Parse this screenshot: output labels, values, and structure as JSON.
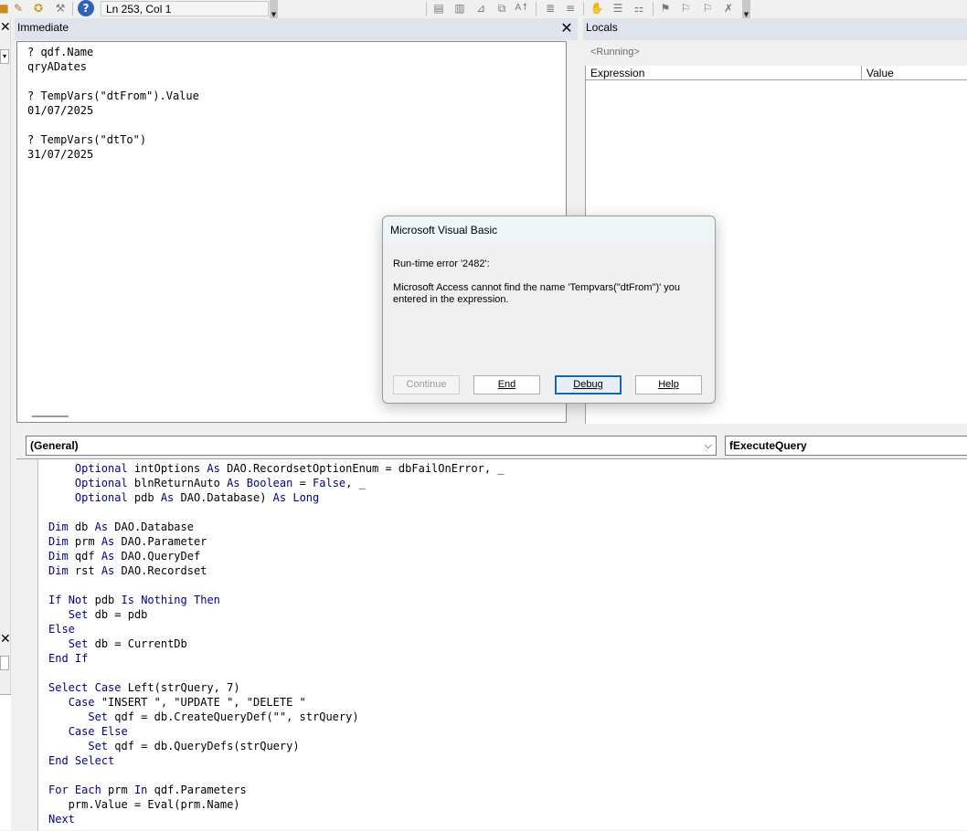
{
  "toolbar": {
    "status": "Ln 253, Col 1",
    "icons_left": [
      "toolbox-icon",
      "debug-icon",
      "tools-icon",
      "help-icon"
    ],
    "icons_right": [
      "indent-icon",
      "outdent-icon",
      "hand-icon",
      "bookmark-icon",
      "bookmark-next-icon",
      "bookmark-prev-icon",
      "clear-bookmarks-icon"
    ]
  },
  "immediate": {
    "title": "Immediate",
    "lines": [
      "? qdf.Name",
      "qryADates",
      "",
      "? TempVars(\"dtFrom\").Value",
      "01/07/2025",
      "",
      "? TempVars(\"dtTo\")",
      "31/07/2025"
    ]
  },
  "locals": {
    "title": "Locals",
    "context": "<Running>",
    "columns": [
      "Expression",
      "Value"
    ]
  },
  "code": {
    "object_combo": "(General)",
    "procedure_combo": "fExecuteQuery",
    "lines": [
      [
        [
          "    ",
          ""
        ],
        [
          "Optional",
          "kw"
        ],
        [
          " intOptions ",
          ""
        ],
        [
          "As",
          "kw"
        ],
        [
          " DAO.RecordsetOptionEnum = dbFailOnError, _",
          ""
        ]
      ],
      [
        [
          "    ",
          ""
        ],
        [
          "Optional",
          "kw"
        ],
        [
          " blnReturnAuto ",
          ""
        ],
        [
          "As",
          "kw"
        ],
        [
          " ",
          ""
        ],
        [
          "Boolean",
          "kw"
        ],
        [
          " = ",
          ""
        ],
        [
          "False",
          "kw"
        ],
        [
          ", _",
          ""
        ]
      ],
      [
        [
          "    ",
          ""
        ],
        [
          "Optional",
          "kw"
        ],
        [
          " pdb ",
          ""
        ],
        [
          "As",
          "kw"
        ],
        [
          " DAO.Database) ",
          ""
        ],
        [
          "As",
          "kw"
        ],
        [
          " ",
          ""
        ],
        [
          "Long",
          "kw"
        ]
      ],
      [],
      [
        [
          "Dim",
          "kw"
        ],
        [
          " db ",
          ""
        ],
        [
          "As",
          "kw"
        ],
        [
          " DAO.Database",
          ""
        ]
      ],
      [
        [
          "Dim",
          "kw"
        ],
        [
          " prm ",
          ""
        ],
        [
          "As",
          "kw"
        ],
        [
          " DAO.Parameter",
          ""
        ]
      ],
      [
        [
          "Dim",
          "kw"
        ],
        [
          " qdf ",
          ""
        ],
        [
          "As",
          "kw"
        ],
        [
          " DAO.QueryDef",
          ""
        ]
      ],
      [
        [
          "Dim",
          "kw"
        ],
        [
          " rst ",
          ""
        ],
        [
          "As",
          "kw"
        ],
        [
          " DAO.Recordset",
          ""
        ]
      ],
      [],
      [
        [
          "If",
          "kw"
        ],
        [
          " ",
          ""
        ],
        [
          "Not",
          "kw"
        ],
        [
          " pdb ",
          ""
        ],
        [
          "Is",
          "kw"
        ],
        [
          " ",
          ""
        ],
        [
          "Nothing",
          "kw"
        ],
        [
          " ",
          ""
        ],
        [
          "Then",
          "kw"
        ]
      ],
      [
        [
          "   ",
          ""
        ],
        [
          "Set",
          "kw"
        ],
        [
          " db = pdb",
          ""
        ]
      ],
      [
        [
          "Else",
          "kw"
        ]
      ],
      [
        [
          "   ",
          ""
        ],
        [
          "Set",
          "kw"
        ],
        [
          " db = CurrentDb",
          ""
        ]
      ],
      [
        [
          "End",
          "kw"
        ],
        [
          " ",
          ""
        ],
        [
          "If",
          "kw"
        ]
      ],
      [],
      [
        [
          "Select",
          "kw"
        ],
        [
          " ",
          ""
        ],
        [
          "Case",
          "kw"
        ],
        [
          " Left(strQuery, 7)",
          ""
        ]
      ],
      [
        [
          "   ",
          ""
        ],
        [
          "Case",
          "kw"
        ],
        [
          " \"INSERT \", \"UPDATE \", \"DELETE \"",
          ""
        ]
      ],
      [
        [
          "      ",
          ""
        ],
        [
          "Set",
          "kw"
        ],
        [
          " qdf = db.CreateQueryDef(\"\", strQuery)",
          ""
        ]
      ],
      [
        [
          "   ",
          ""
        ],
        [
          "Case",
          "kw"
        ],
        [
          " ",
          ""
        ],
        [
          "Else",
          "kw"
        ]
      ],
      [
        [
          "      ",
          ""
        ],
        [
          "Set",
          "kw"
        ],
        [
          " qdf = db.QueryDefs(strQuery)",
          ""
        ]
      ],
      [
        [
          "End",
          "kw"
        ],
        [
          " ",
          ""
        ],
        [
          "Select",
          "kw"
        ]
      ],
      [],
      [
        [
          "For",
          "kw"
        ],
        [
          " ",
          ""
        ],
        [
          "Each",
          "kw"
        ],
        [
          " prm ",
          ""
        ],
        [
          "In",
          "kw"
        ],
        [
          " qdf.Parameters",
          ""
        ]
      ],
      [
        [
          "   prm.Value = Eval(prm.Name)",
          ""
        ]
      ],
      [
        [
          "Next",
          "kw"
        ]
      ]
    ]
  },
  "dialog": {
    "title": "Microsoft Visual Basic",
    "error": "Run-time error '2482':",
    "message": "Microsoft Access cannot find the name 'Tempvars(\"dtFrom\")' you entered in the expression.",
    "buttons": {
      "continue": "Continue",
      "end": "End",
      "debug": "Debug",
      "help": "Help"
    }
  },
  "colors": {
    "keyword": "#00008b",
    "pane_header": "#dfe4ec",
    "focus": "#1064c4"
  }
}
